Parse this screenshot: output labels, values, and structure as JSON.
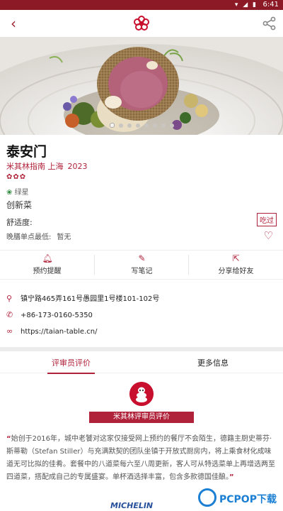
{
  "status_bar": {
    "time": "6:41",
    "icons": [
      "wifi-icon",
      "signal-icon",
      "battery-icon"
    ]
  },
  "header": {
    "back_icon": "back-arrow-icon",
    "logo_icon": "michelin-flower-logo",
    "share_icon": "share-icon"
  },
  "carousel": {
    "dot_count": 8,
    "active_index": 0
  },
  "restaurant": {
    "name": "泰安门",
    "guide": "米其林指南 上海",
    "year": "2023",
    "stars_label": "✿✿✿",
    "green_star": "绿星",
    "cuisine": "创新菜",
    "comfort_label": "舒适度:",
    "price_label": "晚膳单点最低:",
    "price_value": "暂无",
    "visited_badge": "吃过"
  },
  "actions": [
    {
      "label": "预约提醒",
      "icon": "bell-icon"
    },
    {
      "label": "写笔记",
      "icon": "pencil-icon"
    },
    {
      "label": "分享给好友",
      "icon": "share-box-icon"
    }
  ],
  "info": {
    "address": "镇宁路465弄161号愚园里1号楼101-102号",
    "phone": "+86-173-0160-5350",
    "website": "https://taian-table.cn/"
  },
  "tabs": [
    {
      "label": "评审员评价",
      "active": true
    },
    {
      "label": "更多信息",
      "active": false
    }
  ],
  "review": {
    "banner": "米其林评审员评价",
    "open_quote": "“",
    "text": "始创于2016年，城中老饕对这家仅接受网上预约的餐厅不会陌生，德籍主厨史蒂芬·斯蒂勒（Stefan Stiller）与充满默契的团队坐镇于开放式厨房内，将上乘食材化成味道无可比拟的佳肴。套餐中的八道菜每六至八周更新，客人可从特选菜单上再增选两至四道菜，搭配成自己的专属盛宴。单杯酒选择丰富，包含多款德国佳酿。",
    "close_quote": "”"
  },
  "footer": {
    "brand": "MICHELIN"
  },
  "watermark": {
    "text": "PCPOP下载"
  },
  "colors": {
    "accent": "#b0223a",
    "status_bar": "#8b1a26",
    "watermark": "#1b7fd4"
  }
}
